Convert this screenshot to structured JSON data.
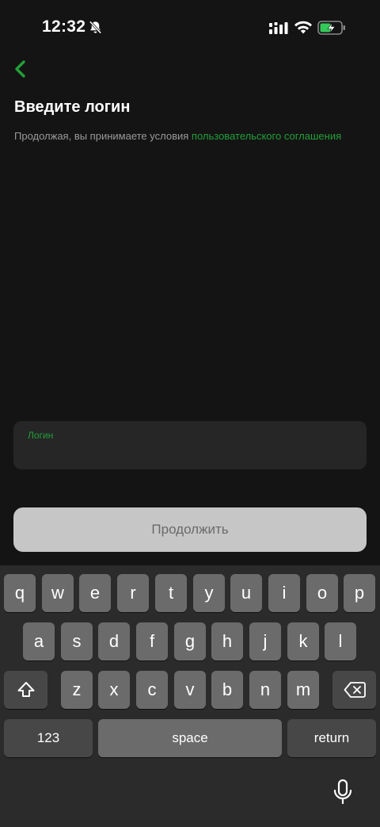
{
  "status_bar": {
    "time": "12:32"
  },
  "screen": {
    "title": "Введите логин",
    "terms_prefix": "Продолжая, вы принимаете условия ",
    "terms_link": "пользовательского соглашения"
  },
  "login_field": {
    "label": "Логин",
    "value": ""
  },
  "continue_button": {
    "label": "Продолжить"
  },
  "keyboard": {
    "row1": [
      "q",
      "w",
      "e",
      "r",
      "t",
      "y",
      "u",
      "i",
      "o",
      "p"
    ],
    "row2": [
      "a",
      "s",
      "d",
      "f",
      "g",
      "h",
      "j",
      "k",
      "l"
    ],
    "row3": [
      "z",
      "x",
      "c",
      "v",
      "b",
      "n",
      "m"
    ],
    "numbers_label": "123",
    "space_label": "space",
    "return_label": "return"
  },
  "colors": {
    "accent": "#21a038",
    "background": "#141414"
  }
}
